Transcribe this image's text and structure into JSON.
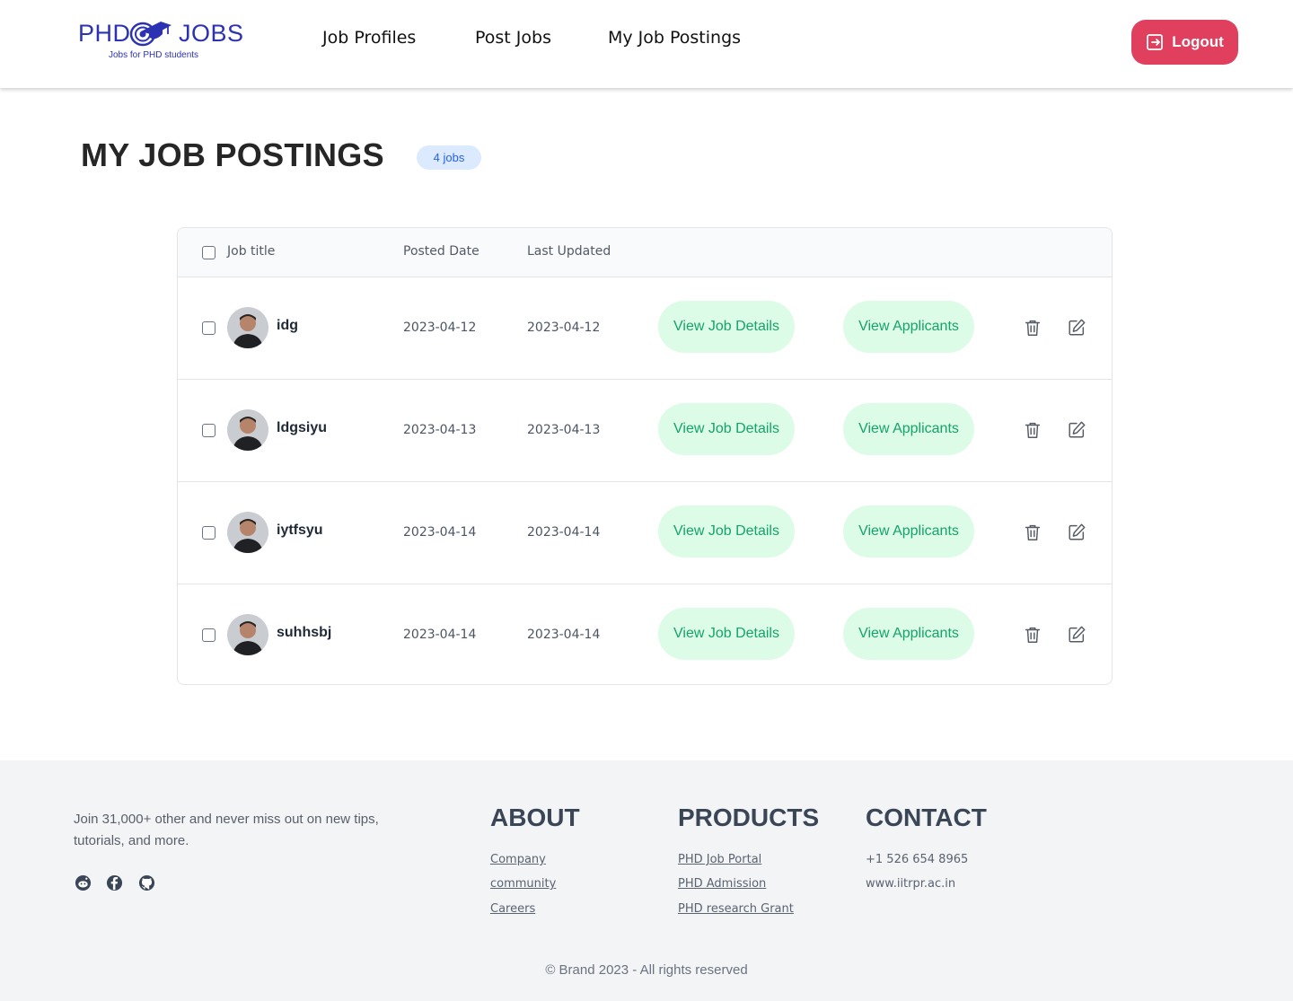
{
  "brand": {
    "name_part1": "PHD",
    "name_part2": "JOBS",
    "tagline": "Jobs for PHD students",
    "color": "#2b33b3"
  },
  "nav": {
    "items": [
      {
        "label": "Job Profiles"
      },
      {
        "label": "Post Jobs"
      },
      {
        "label": "My Job Postings"
      }
    ],
    "logout_label": "Logout",
    "logout_color": "#e0405e"
  },
  "page": {
    "title": "MY JOB POSTINGS",
    "count_badge": "4 jobs"
  },
  "table": {
    "headers": {
      "job_title": "Job title",
      "posted_date": "Posted Date",
      "last_updated": "Last Updated"
    },
    "view_details_label": "View Job Details",
    "view_applicants_label": "View Applicants",
    "rows": [
      {
        "title": "idg",
        "posted": "2023-04-12",
        "updated": "2023-04-12"
      },
      {
        "title": "ldgsiyu",
        "posted": "2023-04-13",
        "updated": "2023-04-13"
      },
      {
        "title": "iytfsyu",
        "posted": "2023-04-14",
        "updated": "2023-04-14"
      },
      {
        "title": "suhhsbj",
        "posted": "2023-04-14",
        "updated": "2023-04-14"
      }
    ]
  },
  "footer": {
    "join_text": "Join 31,000+ other and never miss out on new tips, tutorials, and more.",
    "social_icons": [
      "reddit-icon",
      "facebook-icon",
      "github-icon"
    ],
    "about": {
      "heading": "ABOUT",
      "links": [
        "Company",
        "community",
        "Careers"
      ]
    },
    "products": {
      "heading": "PRODUCTS",
      "links": [
        "PHD Job Portal",
        "PHD Admission",
        "PHD research Grant"
      ]
    },
    "contact": {
      "heading": "CONTACT",
      "phone": "+1 526 654 8965",
      "website": "www.iitrpr.ac.in"
    },
    "copyright": "© Brand 2023 - All rights reserved"
  }
}
